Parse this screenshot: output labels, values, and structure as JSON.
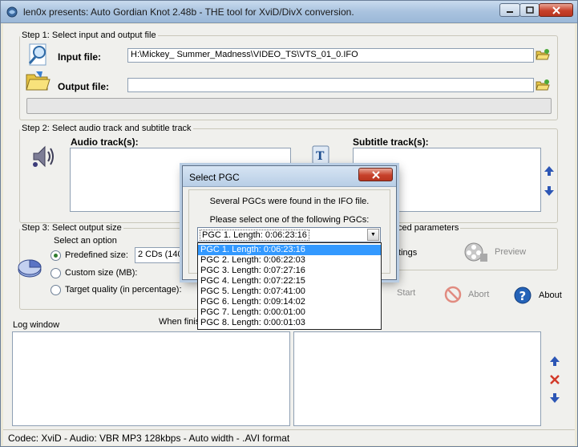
{
  "window": {
    "title": "len0x presents: Auto Gordian Knot 2.48b - THE tool for XviD/DivX conversion."
  },
  "step1": {
    "label": "Step 1: Select input and output file",
    "input_label": "Input file:",
    "input_value": "H:\\Mickey_ Summer_Madness\\VIDEO_TS\\VTS_01_0.IFO",
    "output_label": "Output file:",
    "output_value": ""
  },
  "step2": {
    "label": "Step 2: Select audio track and subtitle track",
    "audio_label": "Audio track(s):",
    "subtitle_label": "Subtitle track(s):"
  },
  "step3": {
    "label": "Step 3: Select output size",
    "option_group": "Select an option",
    "predefined": "Predefined size:",
    "custom": "Custom size (MB):",
    "quality": "Target quality (in percentage):",
    "size_value": "2 CDs (1400"
  },
  "advanced": {
    "label_fragment": "ced parameters",
    "settings_fragment": "ttings",
    "preview": "Preview"
  },
  "actions": {
    "start": "Start",
    "abort": "Abort",
    "about": "About"
  },
  "log": {
    "label": "Log window",
    "when_finished_fragment": "When finis"
  },
  "statusbar": {
    "text": "Codec: XviD -   Audio: VBR MP3 128kbps -   Auto width -  .AVI format"
  },
  "dialog": {
    "title": "Select PGC",
    "line1": "Several PGCs were found in the IFO file.",
    "line2": "Please select one of the following PGCs:",
    "selected": "PGC 1. Length: 0:06:23:16",
    "options": [
      "PGC 1. Length: 0:06:23:16",
      "PGC 2. Length: 0:06:22:03",
      "PGC 3. Length: 0:07:27:16",
      "PGC 4. Length: 0:07:22:15",
      "PGC 5. Length: 0:07:41:00",
      "PGC 6. Length: 0:09:14:02",
      "PGC 7. Length: 0:00:01:00",
      "PGC 8. Length: 0:00:01:03"
    ]
  }
}
